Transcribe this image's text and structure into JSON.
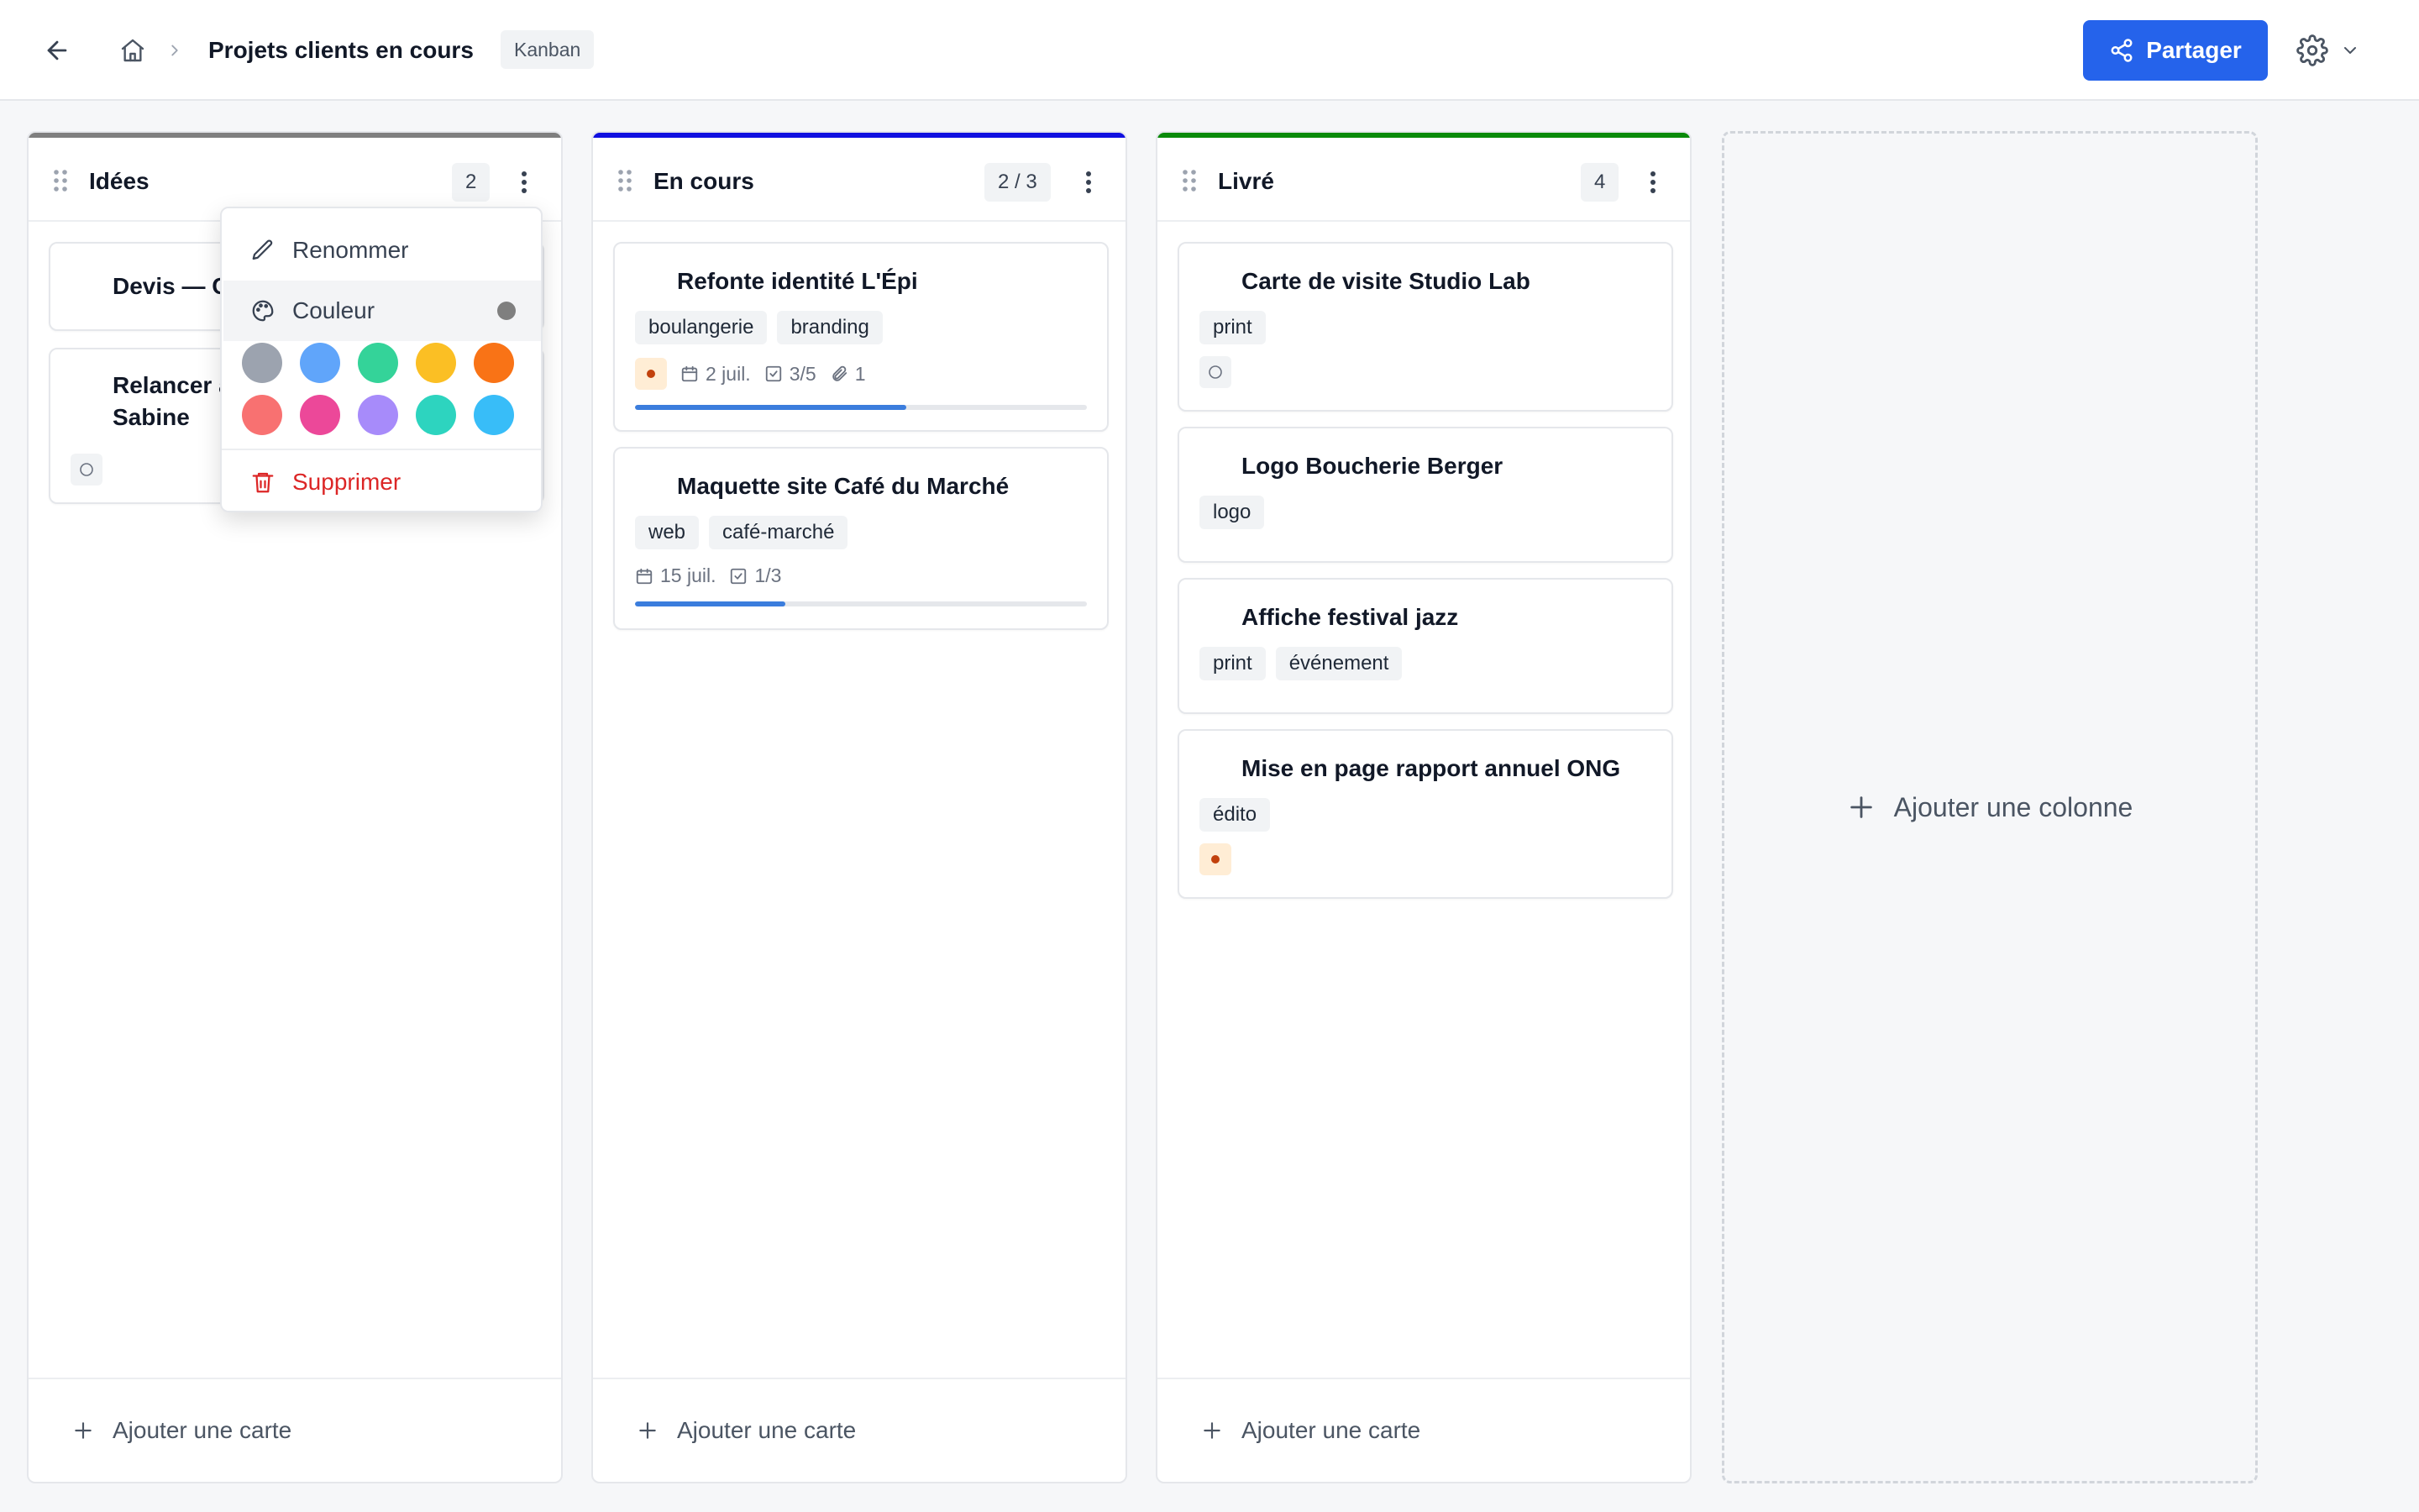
{
  "header": {
    "board_title": "Projets clients en cours",
    "view_badge": "Kanban",
    "share_label": "Partager"
  },
  "columns": [
    {
      "title": "Idées",
      "count": "2",
      "accent": "#7f7f7f",
      "cards": [
        {
          "title": "Devis — C"
        },
        {
          "title": "Relancer a Sabine",
          "title_line1": "Relancer a",
          "title_line2": "Sabine"
        }
      ]
    },
    {
      "title": "En cours",
      "count": "2 / 3",
      "accent": "#1010e0",
      "cards": [
        {
          "title": "Refonte identité L'Épi",
          "tags": [
            "boulangerie",
            "branding"
          ],
          "date": "2 juil.",
          "checklist": "3/5",
          "attachments": "1",
          "progress": 0.6
        },
        {
          "title": "Maquette site Café du Marché",
          "tags": [
            "web",
            "café-marché"
          ],
          "date": "15 juil.",
          "checklist": "1/3",
          "progress": 0.333
        }
      ]
    },
    {
      "title": "Livré",
      "count": "4",
      "accent": "#0a8a0a",
      "cards": [
        {
          "title": "Carte de visite Studio Lab",
          "tags": [
            "print"
          ]
        },
        {
          "title": "Logo Boucherie Berger",
          "tags": [
            "logo"
          ]
        },
        {
          "title": "Affiche festival jazz",
          "tags": [
            "print",
            "événement"
          ]
        },
        {
          "title": "Mise en page rapport annuel ONG",
          "tags": [
            "édito"
          ]
        }
      ]
    }
  ],
  "add_card_label": "Ajouter une carte",
  "add_column_label": "Ajouter une colonne",
  "context_menu": {
    "rename": "Renommer",
    "color": "Couleur",
    "delete": "Supprimer",
    "current_color": "#7f7f7f",
    "swatches": [
      "#9ca3af",
      "#60a5fa",
      "#34d399",
      "#fbbf24",
      "#f97316",
      "#f87171",
      "#ec4899",
      "#a78bfa",
      "#2dd4bf",
      "#38bdf8"
    ]
  },
  "colors": {
    "primary": "#2563eb",
    "danger": "#dc2626",
    "priority_high": "#c2410c",
    "progress": "#3b7ddd"
  }
}
